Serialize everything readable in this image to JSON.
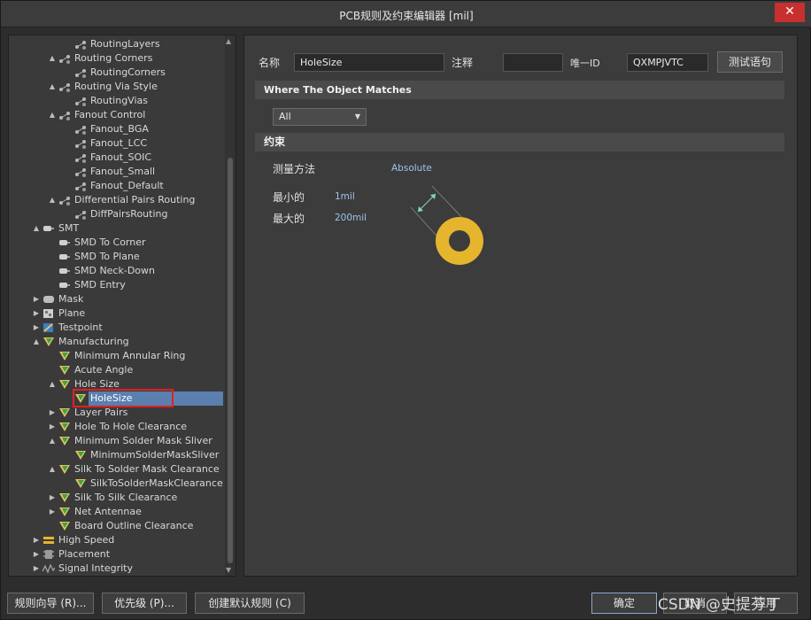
{
  "window": {
    "title": "PCB规则及约束编辑器 [mil]",
    "close_label": "✕"
  },
  "tree": {
    "rows": [
      {
        "label": "RoutingLayers",
        "level": 3,
        "expander": "",
        "icon": "rule-branch-icon"
      },
      {
        "label": "Routing Corners",
        "level": 2,
        "expander": "▲",
        "icon": "rule-branch-icon"
      },
      {
        "label": "RoutingCorners",
        "level": 3,
        "expander": "",
        "icon": "rule-branch-icon"
      },
      {
        "label": "Routing Via Style",
        "level": 2,
        "expander": "▲",
        "icon": "rule-branch-icon"
      },
      {
        "label": "RoutingVias",
        "level": 3,
        "expander": "",
        "icon": "rule-branch-icon"
      },
      {
        "label": "Fanout Control",
        "level": 2,
        "expander": "▲",
        "icon": "rule-branch-icon"
      },
      {
        "label": "Fanout_BGA",
        "level": 3,
        "expander": "",
        "icon": "rule-branch-icon"
      },
      {
        "label": "Fanout_LCC",
        "level": 3,
        "expander": "",
        "icon": "rule-branch-icon"
      },
      {
        "label": "Fanout_SOIC",
        "level": 3,
        "expander": "",
        "icon": "rule-branch-icon"
      },
      {
        "label": "Fanout_Small",
        "level": 3,
        "expander": "",
        "icon": "rule-branch-icon"
      },
      {
        "label": "Fanout_Default",
        "level": 3,
        "expander": "",
        "icon": "rule-branch-icon"
      },
      {
        "label": "Differential Pairs Routing",
        "level": 2,
        "expander": "▲",
        "icon": "rule-branch-icon"
      },
      {
        "label": "DiffPairsRouting",
        "level": 3,
        "expander": "",
        "icon": "rule-branch-icon"
      },
      {
        "label": "SMT",
        "level": 1,
        "expander": "▲",
        "icon": "smt-icon"
      },
      {
        "label": "SMD To Corner",
        "level": 2,
        "expander": "",
        "icon": "smt-icon"
      },
      {
        "label": "SMD To Plane",
        "level": 2,
        "expander": "",
        "icon": "smt-icon"
      },
      {
        "label": "SMD Neck-Down",
        "level": 2,
        "expander": "",
        "icon": "smt-icon"
      },
      {
        "label": "SMD Entry",
        "level": 2,
        "expander": "",
        "icon": "smt-icon"
      },
      {
        "label": "Mask",
        "level": 1,
        "expander": "▶",
        "icon": "mask-icon"
      },
      {
        "label": "Plane",
        "level": 1,
        "expander": "▶",
        "icon": "plane-icon"
      },
      {
        "label": "Testpoint",
        "level": 1,
        "expander": "▶",
        "icon": "testpoint-icon"
      },
      {
        "label": "Manufacturing",
        "level": 1,
        "expander": "▲",
        "icon": "manufacturing-icon"
      },
      {
        "label": "Minimum Annular Ring",
        "level": 2,
        "expander": "",
        "icon": "manufacturing-icon"
      },
      {
        "label": "Acute Angle",
        "level": 2,
        "expander": "",
        "icon": "manufacturing-icon"
      },
      {
        "label": "Hole Size",
        "level": 2,
        "expander": "▲",
        "icon": "manufacturing-icon"
      },
      {
        "label": "HoleSize",
        "level": 3,
        "expander": "",
        "icon": "manufacturing-icon",
        "selected": true
      },
      {
        "label": "Layer Pairs",
        "level": 2,
        "expander": "▶",
        "icon": "manufacturing-icon"
      },
      {
        "label": "Hole To Hole Clearance",
        "level": 2,
        "expander": "▶",
        "icon": "manufacturing-icon"
      },
      {
        "label": "Minimum Solder Mask Sliver",
        "level": 2,
        "expander": "▲",
        "icon": "manufacturing-icon"
      },
      {
        "label": "MinimumSolderMaskSliver",
        "level": 3,
        "expander": "",
        "icon": "manufacturing-icon"
      },
      {
        "label": "Silk To Solder Mask Clearance",
        "level": 2,
        "expander": "▲",
        "icon": "manufacturing-icon"
      },
      {
        "label": "SilkToSolderMaskClearance",
        "level": 3,
        "expander": "",
        "icon": "manufacturing-icon"
      },
      {
        "label": "Silk To Silk Clearance",
        "level": 2,
        "expander": "▶",
        "icon": "manufacturing-icon"
      },
      {
        "label": "Net Antennae",
        "level": 2,
        "expander": "▶",
        "icon": "manufacturing-icon"
      },
      {
        "label": "Board Outline Clearance",
        "level": 2,
        "expander": "",
        "icon": "manufacturing-icon"
      },
      {
        "label": "High Speed",
        "level": 1,
        "expander": "▶",
        "icon": "high-speed-icon"
      },
      {
        "label": "Placement",
        "level": 1,
        "expander": "▶",
        "icon": "placement-icon"
      },
      {
        "label": "Signal Integrity",
        "level": 1,
        "expander": "▶",
        "icon": "signal-integrity-icon"
      }
    ]
  },
  "rule": {
    "name_label": "名称",
    "name_value": "HoleSize",
    "comment_label": "注释",
    "comment_value": "",
    "uid_label": "唯一ID",
    "uid_value": "QXMPJVTC",
    "test_button": "测试语句",
    "where_header": "Where The Object Matches",
    "scope_value": "All",
    "constraints_header": "约束",
    "measure_label": "测量方法",
    "measure_value": "Absolute",
    "min_label": "最小的",
    "min_value": "1mil",
    "max_label": "最大的",
    "max_value": "200mil"
  },
  "footer": {
    "wizard_button": "规则向导 (R)...",
    "priority_button": "优先级 (P)...",
    "create_default_button": "创建默认规则 (C)",
    "ok_button": "确定",
    "cancel_button": "取消",
    "apply_button": "应用"
  },
  "watermark": "CSDN @史提芬丁",
  "colors": {
    "accent": "#5b7fae",
    "highlight_outline": "#e02020",
    "annulus": "#e6b52e"
  }
}
